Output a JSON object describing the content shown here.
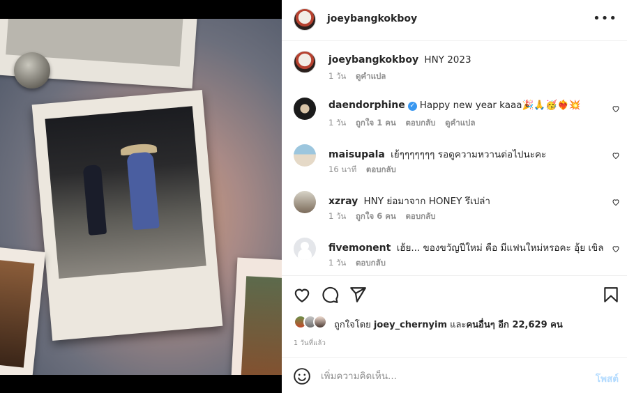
{
  "post": {
    "username": "joeybangkokboy",
    "caption_username": "joeybangkokboy",
    "caption": "HNY 2023",
    "caption_time": "1 วัน",
    "caption_translate": "ดูคำแปล"
  },
  "comments": [
    {
      "username": "daendorphine",
      "verified": true,
      "text": "Happy new year kaaa🎉🙏🥳❤️‍🔥💥",
      "time": "1 วัน",
      "likes": "ถูกใจ 1 คน",
      "reply": "ตอบกลับ",
      "translate": "ดูคำแปล"
    },
    {
      "username": "maisupala",
      "text": "เย้ๆๆๆๆๆๆๆ รอดูความหวานต่อไปนะคะ",
      "time": "16 นาที",
      "reply": "ตอบกลับ"
    },
    {
      "username": "xzray",
      "text": "HNY ย่อมาจาก HONEY รึเปล่า",
      "time": "1 วัน",
      "likes": "ถูกใจ 6 คน",
      "reply": "ตอบกลับ"
    },
    {
      "username": "fivemonent",
      "text": "เฮ้ย... ของขวัญปีใหม่ คือ มีแฟนใหม่หรอคะ อุ้ย เขิล",
      "time": "1 วัน",
      "reply": "ตอบกลับ"
    }
  ],
  "likes": {
    "prefix": "ถูกใจโดย",
    "user": "joey_chernyim",
    "and": "และ",
    "others": "คนอื่นๆ อีก 22,629 คน"
  },
  "time_ago": "1 วันที่แล้ว",
  "composer": {
    "placeholder": "เพิ่มความคิดเห็น...",
    "post_label": "โพสต์"
  },
  "icons": {
    "more": "more-options-icon",
    "like": "heart-icon",
    "comment": "comment-icon",
    "share": "share-icon",
    "save": "bookmark-icon",
    "emoji": "emoji-icon"
  }
}
